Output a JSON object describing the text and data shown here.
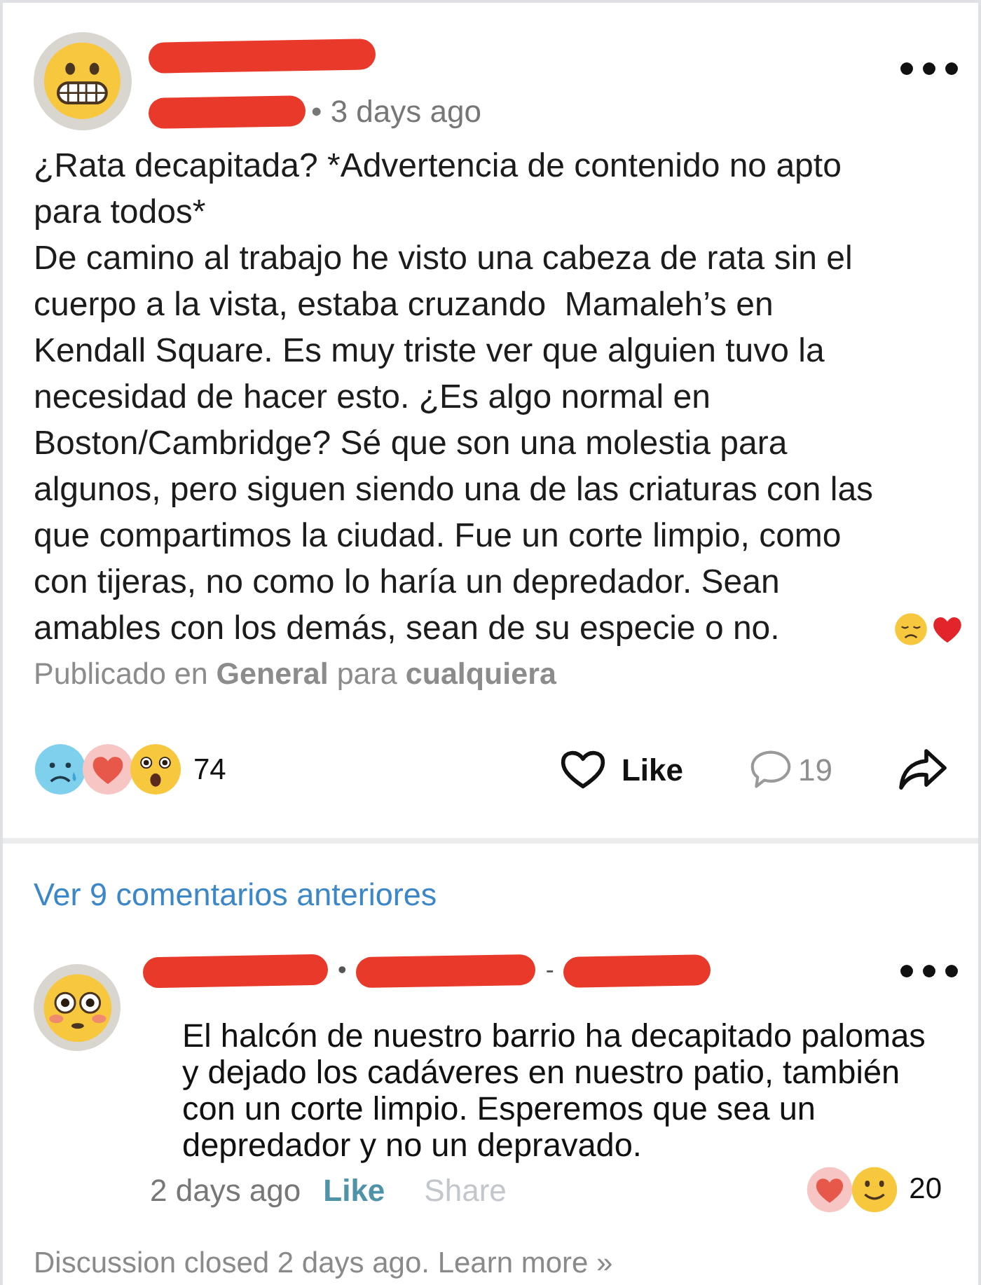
{
  "post": {
    "avatar": {
      "kind": "grimacing"
    },
    "name_line": [
      {
        "kind": "redaction"
      }
    ],
    "meta_line": [
      {
        "kind": "redaction"
      },
      {
        "kind": "text",
        "text": "• 3 days ago"
      }
    ],
    "title": "¿Rata decapitada? *Advertencia de contenido no apto para todos*",
    "body": "De camino al trabajo he visto una cabeza de rata sin el cuerpo a la vista, estaba cruzando  Mamaleh’s en Kendall Square. Es muy triste ver que alguien tuvo la necesidad de hacer esto. ¿Es algo normal en Boston/Cambridge? Sé que son una molestia para algunos, pero siguen siendo una de las criaturas con las que compartimos la ciudad. Fue un corte limpio, como con tijeras, no como lo haría un depredador. Sean amables con los demás, sean de su especie o no.",
    "body_emojis": [
      {
        "kind": "disappointed"
      },
      {
        "kind": "heart"
      }
    ],
    "posted_in": "Publicado en **General** para **cualquiera**",
    "reactions": {
      "emojis": [
        {
          "kind": "sad"
        },
        {
          "kind": "love"
        },
        {
          "kind": "astonished"
        }
      ],
      "count": "74"
    },
    "actions": [
      {
        "kind": "like",
        "label": "Like"
      },
      {
        "kind": "comment",
        "label": "19"
      },
      {
        "kind": "share"
      }
    ]
  },
  "comments_link": "Ver 9 comentarios anteriores",
  "comments": [
    {
      "avatar": {
        "kind": "flushed"
      },
      "header": [
        {
          "kind": "redaction"
        },
        {
          "kind": "separator",
          "text": "•"
        },
        {
          "kind": "redaction"
        },
        {
          "kind": "separator",
          "text": "-"
        },
        {
          "kind": "redaction"
        }
      ],
      "text": "El halcón de nuestro barrio ha decapitado palomas y dejado los cadáveres en nuestro patio, también con un corte limpio. Esperemos que sea un depredador y no un depravado.",
      "time": "2 days ago",
      "actions": [
        {
          "label": "Like",
          "disabled": false
        },
        {
          "label": "Share",
          "disabled": true
        }
      ],
      "reactions": {
        "emojis": [
          {
            "kind": "love"
          },
          {
            "kind": "smile"
          }
        ],
        "count": "20"
      }
    }
  ],
  "footer": "Discussion closed 2 days ago. Learn more »"
}
